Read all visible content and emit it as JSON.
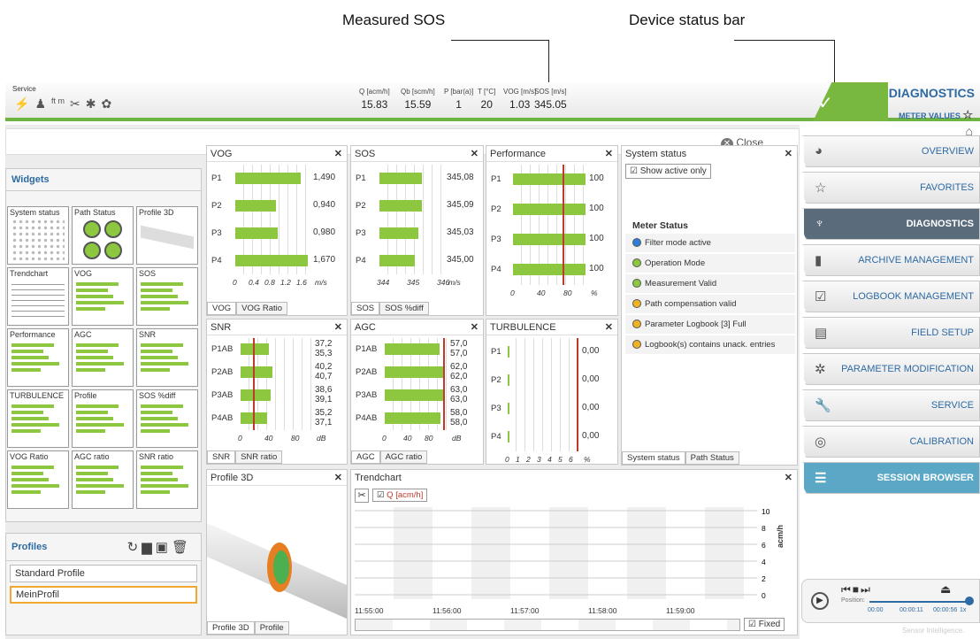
{
  "callouts": {
    "measured_sos": "Measured SOS",
    "device_status": "Device status bar"
  },
  "topbar": {
    "mode": "Service",
    "measures": [
      {
        "label": "Q [acm/h]",
        "value": "15.83"
      },
      {
        "label": "Qb [scm/h]",
        "value": "15.59"
      },
      {
        "label": "P [bar(a)]",
        "value": "1"
      },
      {
        "label": "T [°C]",
        "value": "20"
      },
      {
        "label": "VOG [m/s]",
        "value": "1.03"
      },
      {
        "label": "SOS [m/s]",
        "value": "345.05"
      }
    ],
    "title": "DIAGNOSTICS",
    "subtitle": "METER VALUES"
  },
  "close_label": "Close",
  "widgets": {
    "title": "Widgets",
    "items": [
      "System status",
      "Path Status",
      "Profile 3D",
      "Trendchart",
      "VOG",
      "SOS",
      "Performance",
      "AGC",
      "SNR",
      "TURBULENCE",
      "Profile",
      "SOS %diff",
      "VOG Ratio",
      "AGC ratio",
      "SNR ratio"
    ]
  },
  "profiles": {
    "title": "Profiles",
    "items": [
      "Standard Profile",
      "MeinProfil"
    ]
  },
  "vog": {
    "title": "VOG",
    "paths": [
      "P1",
      "P2",
      "P3",
      "P4"
    ],
    "values": [
      "1,490",
      "0,940",
      "0,980",
      "1,670"
    ],
    "ticks": [
      "0",
      "0.4",
      "0.8",
      "1.2",
      "1.6"
    ],
    "unit": "m/s",
    "tabs": [
      "VOG",
      "VOG Ratio"
    ]
  },
  "sos": {
    "title": "SOS",
    "paths": [
      "P1",
      "P2",
      "P3",
      "P4"
    ],
    "values": [
      "345,08",
      "345,09",
      "345,03",
      "345,00"
    ],
    "ticks": [
      "344",
      "345",
      "346"
    ],
    "unit": "m/s",
    "tabs": [
      "SOS",
      "SOS %diff"
    ]
  },
  "perf": {
    "title": "Performance",
    "paths": [
      "P1",
      "P2",
      "P3",
      "P4"
    ],
    "values": [
      "100",
      "100",
      "100",
      "100"
    ],
    "ticks": [
      "0",
      "40",
      "80"
    ],
    "unit": "%"
  },
  "snr": {
    "title": "SNR",
    "paths": [
      "P1AB",
      "P2AB",
      "P3AB",
      "P4AB"
    ],
    "values": [
      "37,2",
      "35,3",
      "40,2",
      "40,7",
      "38,6",
      "39,1",
      "35,2",
      "37,1"
    ],
    "ticks": [
      "0",
      "40",
      "80"
    ],
    "unit": "dB",
    "tabs": [
      "SNR",
      "SNR ratio"
    ]
  },
  "agc": {
    "title": "AGC",
    "paths": [
      "P1AB",
      "P2AB",
      "P3AB",
      "P4AB"
    ],
    "values": [
      "57,0",
      "57,0",
      "62,0",
      "62,0",
      "63,0",
      "63,0",
      "58,0",
      "58,0"
    ],
    "ticks": [
      "0",
      "40",
      "80"
    ],
    "unit": "dB",
    "tabs": [
      "AGC",
      "AGC ratio"
    ]
  },
  "turb": {
    "title": "TURBULENCE",
    "paths": [
      "P1",
      "P2",
      "P3",
      "P4"
    ],
    "values": [
      "0,00",
      "0,00",
      "0,00",
      "0,00"
    ],
    "ticks": [
      "0",
      "1",
      "2",
      "3",
      "4",
      "5",
      "6"
    ],
    "unit": "%"
  },
  "sysstat": {
    "title": "System status",
    "show_active": "Show active only",
    "meter_status": "Meter Status",
    "rows": [
      {
        "text": "Filter mode active",
        "color": "#2f7fd6"
      },
      {
        "text": "Operation Mode",
        "color": "#8dc63f"
      },
      {
        "text": "Measurement Valid",
        "color": "#8dc63f"
      },
      {
        "text": "Path compensation valid",
        "color": "#f0b323"
      },
      {
        "text": "Parameter Logbook [3]  Full",
        "color": "#f0b323"
      },
      {
        "text": "Logbook(s) contains unack. entries",
        "color": "#f0b323"
      }
    ],
    "tabs": [
      "System status",
      "Path Status"
    ]
  },
  "profile3d": {
    "title": "Profile 3D",
    "tabs": [
      "Profile 3D",
      "Profile"
    ]
  },
  "trend": {
    "title": "Trendchart",
    "series": "Q [acm/h]",
    "yticks": [
      "10",
      "8",
      "6",
      "4",
      "2",
      "0"
    ],
    "ylabel": "acm/h",
    "xticks": [
      "11:55:00",
      "11:56:00",
      "11:57:00",
      "11:58:00",
      "11:59:00"
    ],
    "fixed": "Fixed"
  },
  "nav": [
    {
      "label": "OVERVIEW",
      "icon": "◕"
    },
    {
      "label": "FAVORITES",
      "icon": "☆"
    },
    {
      "label": "DIAGNOSTICS",
      "icon": "♆"
    },
    {
      "label": "ARCHIVE MANAGEMENT",
      "icon": "▮"
    },
    {
      "label": "LOGBOOK MANAGEMENT",
      "icon": "☑"
    },
    {
      "label": "FIELD SETUP",
      "icon": "▤"
    },
    {
      "label": "PARAMETER MODIFICATION",
      "icon": "✲"
    },
    {
      "label": "SERVICE",
      "icon": "🔧"
    },
    {
      "label": "CALIBRATION",
      "icon": "◎"
    },
    {
      "label": "SESSION BROWSER",
      "icon": "☰"
    }
  ],
  "player": {
    "position": "Position:",
    "t1": "00:00",
    "t2": "00:00:11",
    "t3": "00:00:56",
    "speed": "1x"
  },
  "brand": "Sensor Intelligence."
}
